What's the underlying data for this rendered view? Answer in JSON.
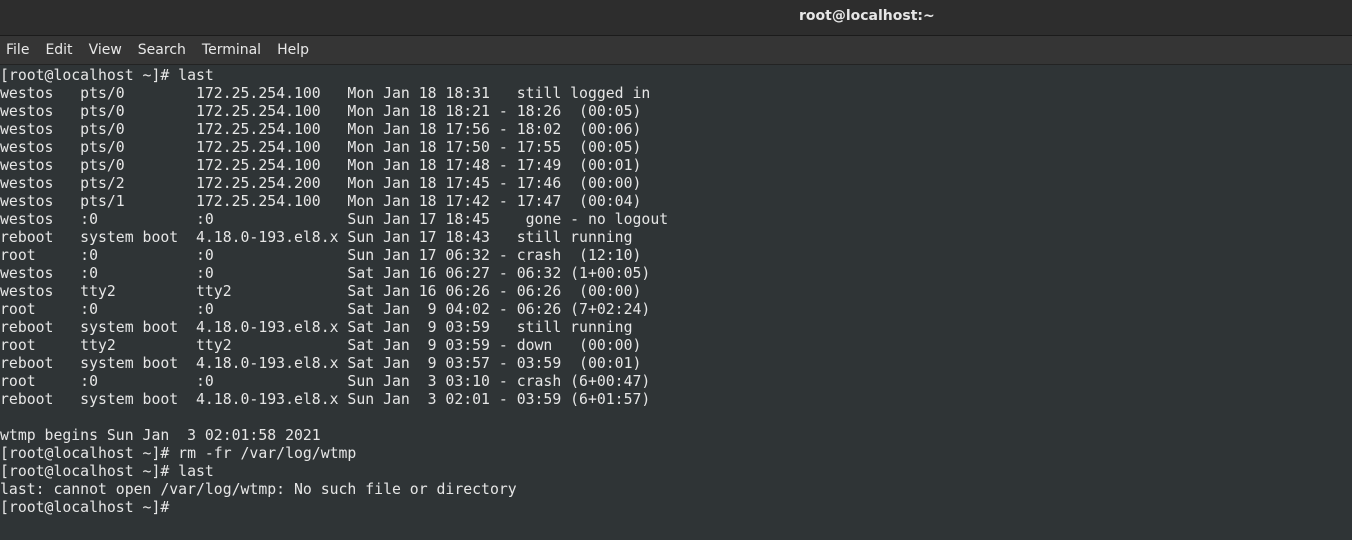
{
  "window": {
    "title": "root@localhost:~"
  },
  "menubar": {
    "items": [
      "File",
      "Edit",
      "View",
      "Search",
      "Terminal",
      "Help"
    ]
  },
  "terminal": {
    "lines": [
      "[root@localhost ~]# last",
      "westos   pts/0        172.25.254.100   Mon Jan 18 18:31   still logged in",
      "westos   pts/0        172.25.254.100   Mon Jan 18 18:21 - 18:26  (00:05)",
      "westos   pts/0        172.25.254.100   Mon Jan 18 17:56 - 18:02  (00:06)",
      "westos   pts/0        172.25.254.100   Mon Jan 18 17:50 - 17:55  (00:05)",
      "westos   pts/0        172.25.254.100   Mon Jan 18 17:48 - 17:49  (00:01)",
      "westos   pts/2        172.25.254.200   Mon Jan 18 17:45 - 17:46  (00:00)",
      "westos   pts/1        172.25.254.100   Mon Jan 18 17:42 - 17:47  (00:04)",
      "westos   :0           :0               Sun Jan 17 18:45    gone - no logout",
      "reboot   system boot  4.18.0-193.el8.x Sun Jan 17 18:43   still running",
      "root     :0           :0               Sun Jan 17 06:32 - crash  (12:10)",
      "westos   :0           :0               Sat Jan 16 06:27 - 06:32 (1+00:05)",
      "westos   tty2         tty2             Sat Jan 16 06:26 - 06:26  (00:00)",
      "root     :0           :0               Sat Jan  9 04:02 - 06:26 (7+02:24)",
      "reboot   system boot  4.18.0-193.el8.x Sat Jan  9 03:59   still running",
      "root     tty2         tty2             Sat Jan  9 03:59 - down   (00:00)",
      "reboot   system boot  4.18.0-193.el8.x Sat Jan  9 03:57 - 03:59  (00:01)",
      "root     :0           :0               Sun Jan  3 03:10 - crash (6+00:47)",
      "reboot   system boot  4.18.0-193.el8.x Sun Jan  3 02:01 - 03:59 (6+01:57)",
      "",
      "wtmp begins Sun Jan  3 02:01:58 2021",
      "[root@localhost ~]# rm -fr /var/log/wtmp",
      "[root@localhost ~]# last",
      "last: cannot open /var/log/wtmp: No such file or directory",
      "[root@localhost ~]# "
    ]
  }
}
